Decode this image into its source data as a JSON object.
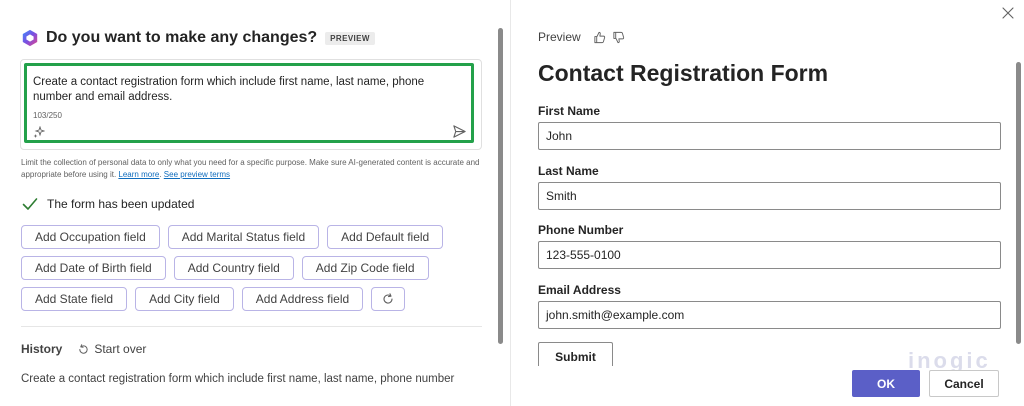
{
  "left": {
    "title": "Do you want to make any changes?",
    "badge": "PREVIEW",
    "prompt": {
      "text": "Create a contact registration form which include first name, last name, phone number and email address.",
      "counter": "103/250"
    },
    "disclaimer": {
      "text": "Limit the collection of personal data to only what you need for a specific purpose. Make sure AI-generated content is accurate and appropriate before using it.",
      "learn_more": "Learn more",
      "preview_terms": "See preview terms"
    },
    "status": "The form has been updated",
    "suggestions": [
      [
        "Add Occupation field",
        "Add Marital Status field",
        "Add Default field"
      ],
      [
        "Add Date of Birth field",
        "Add Country field",
        "Add Zip Code field"
      ],
      [
        "Add State field",
        "Add City field",
        "Add Address field"
      ]
    ],
    "history": {
      "label": "History",
      "start_over": "Start over",
      "item": "Create a contact registration form which include first name, last name, phone number"
    }
  },
  "right": {
    "preview_label": "Preview",
    "form": {
      "title": "Contact Registration Form",
      "fields": [
        {
          "label": "First Name",
          "value": "John"
        },
        {
          "label": "Last Name",
          "value": "Smith"
        },
        {
          "label": "Phone Number",
          "value": "123-555-0100"
        },
        {
          "label": "Email Address",
          "value": "john.smith@example.com"
        }
      ],
      "submit": "Submit"
    },
    "ok": "OK",
    "cancel": "Cancel",
    "watermark": "inogic"
  },
  "colors": {
    "accent": "#5b5fc7",
    "highlight_border": "#23a14a",
    "chip_border": "#b9b4e6",
    "link": "#0f6cbd"
  },
  "icons": [
    "copilot-icon",
    "sparkle-icon",
    "send-icon",
    "check-icon",
    "refresh-icon",
    "start-over-icon",
    "thumbs-up-icon",
    "thumbs-down-icon",
    "close-icon"
  ]
}
